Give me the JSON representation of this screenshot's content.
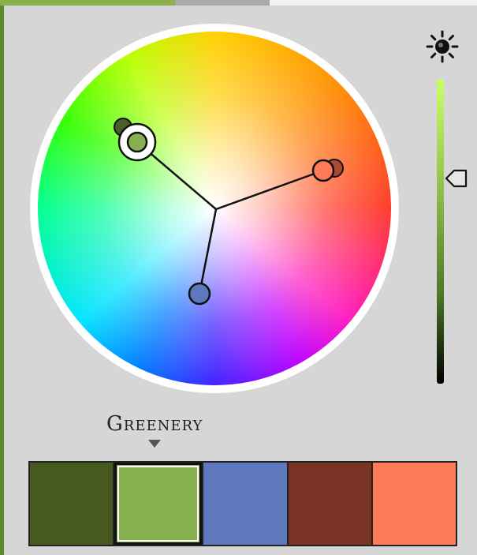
{
  "palette": {
    "name": "Greenery",
    "selected_index": 1,
    "colors": [
      "#47591f",
      "#86b04d",
      "#5e78be",
      "#7a3426",
      "#ff7a57"
    ]
  },
  "wheel": {
    "handles": [
      {
        "name": "green",
        "color": "#86b04d"
      },
      {
        "name": "coral",
        "color": "#ff7a57"
      },
      {
        "name": "blue",
        "color": "#5e78be"
      }
    ]
  },
  "brightness": {
    "icon": "sun-icon",
    "level": 0.69
  },
  "colors": {
    "panel_bg": "#d6d6d6",
    "accent_green": "#8cb04c"
  }
}
